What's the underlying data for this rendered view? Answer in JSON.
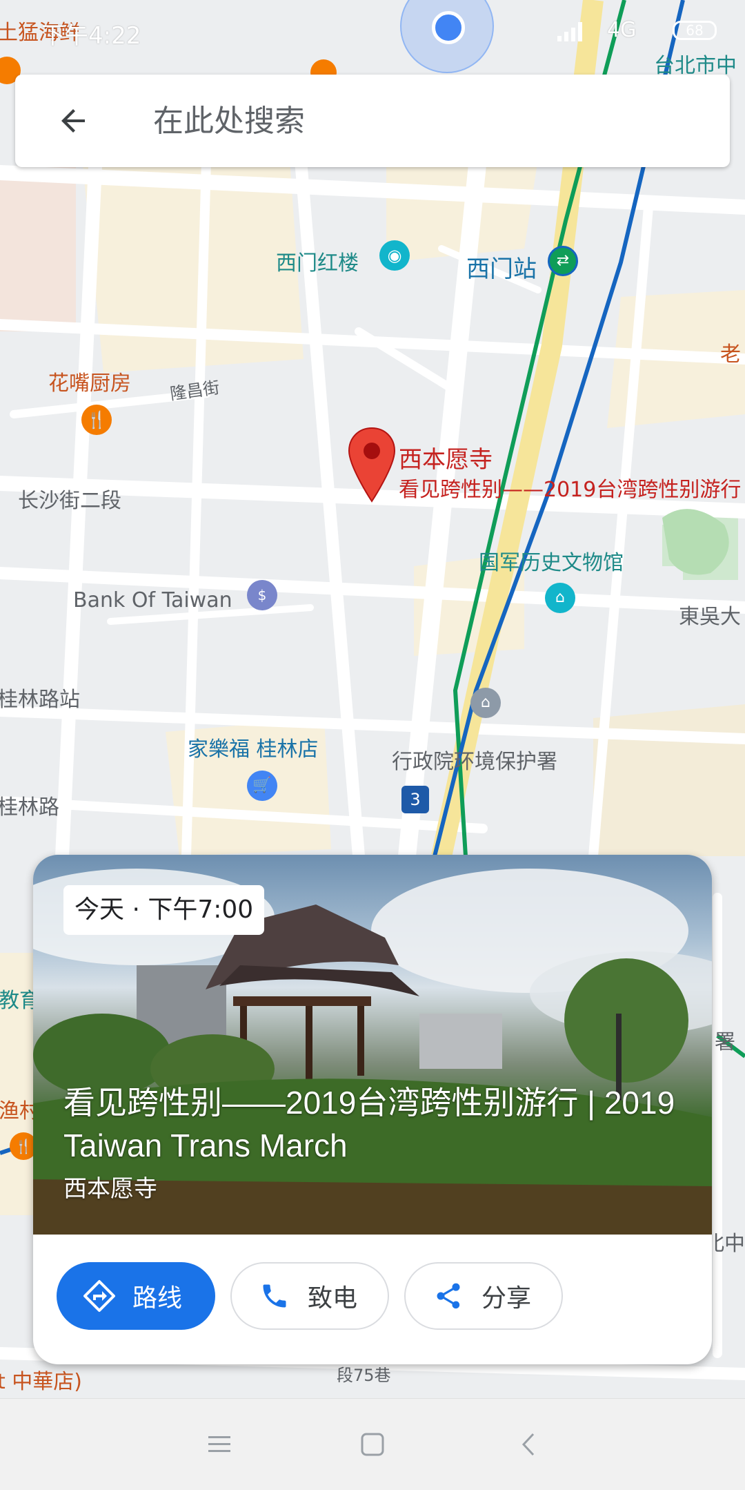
{
  "status_bar": {
    "time": "下午4:22",
    "network": "4G",
    "battery": "68"
  },
  "search": {
    "placeholder": "在此处搜索"
  },
  "map": {
    "labels": {
      "top_left_restaurant": "土猛海鲜",
      "top_right_district": "台北市中",
      "ximen_red_house": "西门红楼",
      "ximen_station": "西门站",
      "huazui_kitchen": "花嘴厨房",
      "longchang_street": "隆昌街",
      "changsha_street": "长沙街二段",
      "bank_of_taiwan": "Bank Of Taiwan",
      "guilin_road_stop": "桂林路站",
      "carrefour": "家樂福 桂林店",
      "guilin_road": "桂林路",
      "museum": "国军历史文物馆",
      "epa": "行政院环境保护署",
      "dongwu": "東吳大",
      "lao": "老",
      "education": "教育",
      "village": "渔村",
      "shu": "署",
      "zhonghua_store": "t 中華店)",
      "lane75": "段75巷",
      "right_zhong": "北中",
      "road_badge": "3"
    },
    "pin": {
      "name": "西本愿寺",
      "event": "看见跨性别——2019台湾跨性别游行"
    }
  },
  "place_card": {
    "time_badge": "今天 · 下午7:00",
    "title": "看见跨性别——2019台湾跨性别游行 | 2019 Taiwan Trans March",
    "subtitle": "西本愿寺",
    "actions": {
      "directions": "路线",
      "call": "致电",
      "share": "分享"
    }
  },
  "colors": {
    "accent": "#1a73e8",
    "pin": "#ea4335",
    "mrt_green": "#0f9d58",
    "mrt_blue": "#1565c0"
  }
}
